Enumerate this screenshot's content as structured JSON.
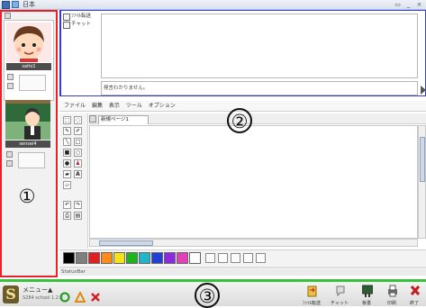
{
  "window": {
    "title": "日本",
    "controls": [
      "minimize-icon",
      "maximize-icon",
      "close-icon"
    ]
  },
  "left_panel": {
    "participants": [
      {
        "name": "saito1",
        "avatar": "student-avatar"
      },
      {
        "name": "sensei4",
        "avatar": "teacher-avatar"
      }
    ]
  },
  "chat": {
    "tabs": [
      {
        "label": "ﾌｧｲﾙ転送",
        "icon": "transfer-icon"
      },
      {
        "label": "チャット",
        "icon": "chat-icon"
      }
    ],
    "input_value": "発言わかりません。"
  },
  "whiteboard": {
    "menu": [
      "ファイル",
      "編集",
      "表示",
      "ツール",
      "オプション"
    ],
    "tools": [
      "select-icon",
      "lasso-icon",
      "pen-icon",
      "marker-icon",
      "line-icon",
      "rectangle-icon",
      "filled-rect-icon",
      "ellipse-icon",
      "filled-ellipse-icon",
      "stamp-icon",
      "fill-icon",
      "text-icon",
      "eraser-icon",
      "undo-icon",
      "redo-icon",
      "print-icon"
    ],
    "page_tab": "新規ページ1",
    "colors": [
      "#000000",
      "#7f7f7f",
      "#e02020",
      "#ff8c1a",
      "#f5e219",
      "#1fb31f",
      "#20b5c9",
      "#2040d8",
      "#8a2be2",
      "#e23fb8",
      "#ffffff"
    ],
    "status_text": "StatusBar"
  },
  "bottom_bar": {
    "menu_label": "メニュー▲",
    "version_label": "S284 school 1.2.0",
    "tools": [
      {
        "label": "ﾌｧｲﾙ転送",
        "icon": "file-transfer-icon"
      },
      {
        "label": "チャット",
        "icon": "chat-icon"
      },
      {
        "label": "板書",
        "icon": "board-icon"
      },
      {
        "label": "印刷",
        "icon": "print-icon"
      },
      {
        "label": "終了",
        "icon": "exit-icon"
      }
    ]
  },
  "callouts": [
    "①",
    "②",
    "③"
  ]
}
